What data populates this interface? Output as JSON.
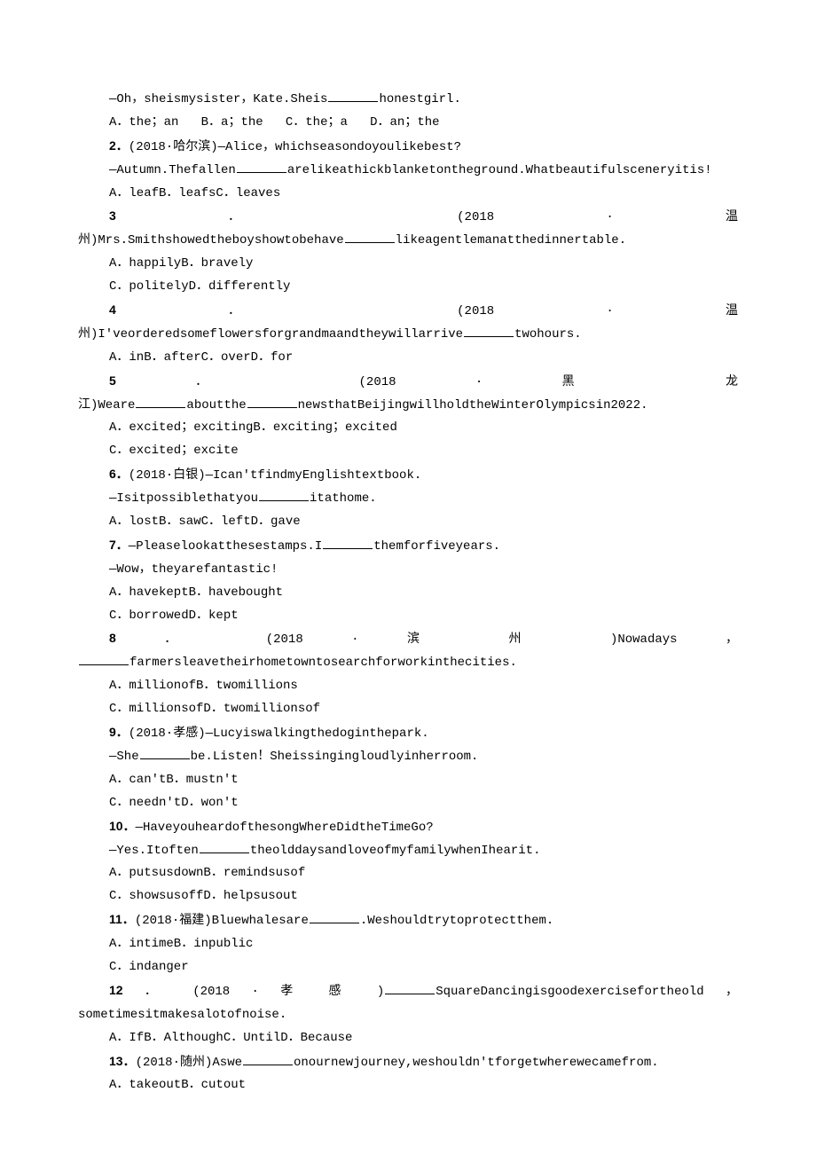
{
  "q1": {
    "dialog": "—Oh，sheismysister，Kate.Sheis",
    "tail": "honestgirl.",
    "a": "A．the；an",
    "b": "B．a；the",
    "c": "C．the；a",
    "d": "D．an；the"
  },
  "q2": {
    "num": "2．",
    "source": "(2018·哈尔滨)—Alice，whichseasondoyoulikebest?",
    "d1": "—Autumn.Thefallen",
    "d2": "arelikeathickblanketontheground.Whatbeautifulsceneryitis!",
    "a": "A．leafB．leafsC．leaves"
  },
  "q3": {
    "num": "3",
    "dot": "．",
    "src": "(2018 · 温",
    "line2a": "州)Mrs.Smithshowedtheboyshowtobehave",
    "line2b": "likeagentlemanatthedinnertable.",
    "a": "A．happilyB．bravely",
    "b": "C．politelyD．differently"
  },
  "q4": {
    "num": "4",
    "dot": "．",
    "src": "(2018 · 温",
    "line2a": "州)I'veorderedsomeflowersforgrandmaandtheywillarrive",
    "line2b": "twohours.",
    "a": "A．inB．afterC．overD．for"
  },
  "q5": {
    "num": "5",
    "dot": "．",
    "src": "(2018 · 黑 龙",
    "line2a": "江)Weare",
    "line2b": "aboutthe",
    "line2c": "newsthatBeijingwillholdtheWinterOlympicsin2022.",
    "a": "A．excited；excitingB．exciting；excited",
    "b": "C．excited；excite"
  },
  "q6": {
    "num": "6．",
    "src": "(2018·白银)—Ican'tfindmyEnglishtextbook.",
    "d1": "—Isitpossiblethatyou",
    "d2": "itathome.",
    "a": "A．lostB．sawC．leftD．gave"
  },
  "q7": {
    "num": "7．",
    "d1": "—Pleaselookatthesestamps.I",
    "d2": "themforfiveyears.",
    "r": "—Wow，theyarefantastic!",
    "a": "A．havekeptB．havebought",
    "b": "C．borrowedD．kept"
  },
  "q8": {
    "num": "8",
    "dot": "．",
    "src": "(2018 · 滨 州 )Nowadays ，",
    "line2b": "farmersleavetheirhometowntosearchforworkinthecities.",
    "a": "A．millionofB．twomillions",
    "b": "C．millionsofD．twomillionsof"
  },
  "q9": {
    "num": "9．",
    "src": "(2018·孝感)—Lucyiswalkingthedoginthepark.",
    "d1": "—She",
    "d2": "be.Listen！Sheissingingloudlyinherroom.",
    "a": "A．can'tB．mustn't",
    "b": "C．needn'tD．won't"
  },
  "q10": {
    "num": "10．",
    "q": "—HaveyouheardofthesongWhereDidtheTimeGo?",
    "d1": "—Yes.Itoften",
    "d2": "theolddaysandloveofmyfamilywhenIhearit.",
    "a": "A．putsusdownB．remindsusof",
    "b": "C．showsusoffD．helpsusout"
  },
  "q11": {
    "num": "11．",
    "src": "(2018·福建)Bluewhalesare",
    "tail": ".Weshouldtrytoprotectthem.",
    "a": "A．intimeB．inpublic",
    "b": "C．indanger"
  },
  "q12": {
    "num": "12",
    "dot": "．",
    "src": "(2018 · 孝 感 )",
    "line1b": "SquareDancingisgoodexercisefortheold ，",
    "line2": "sometimesitmakesalotofnoise.",
    "a": "A．IfB．AlthoughC．UntilD．Because"
  },
  "q13": {
    "num": "13．",
    "src": "(2018·随州)Aswe",
    "tail": "onournewjourney,weshouldn'tforgetwherewecamefrom.",
    "a": "A．takeoutB．cutout"
  }
}
